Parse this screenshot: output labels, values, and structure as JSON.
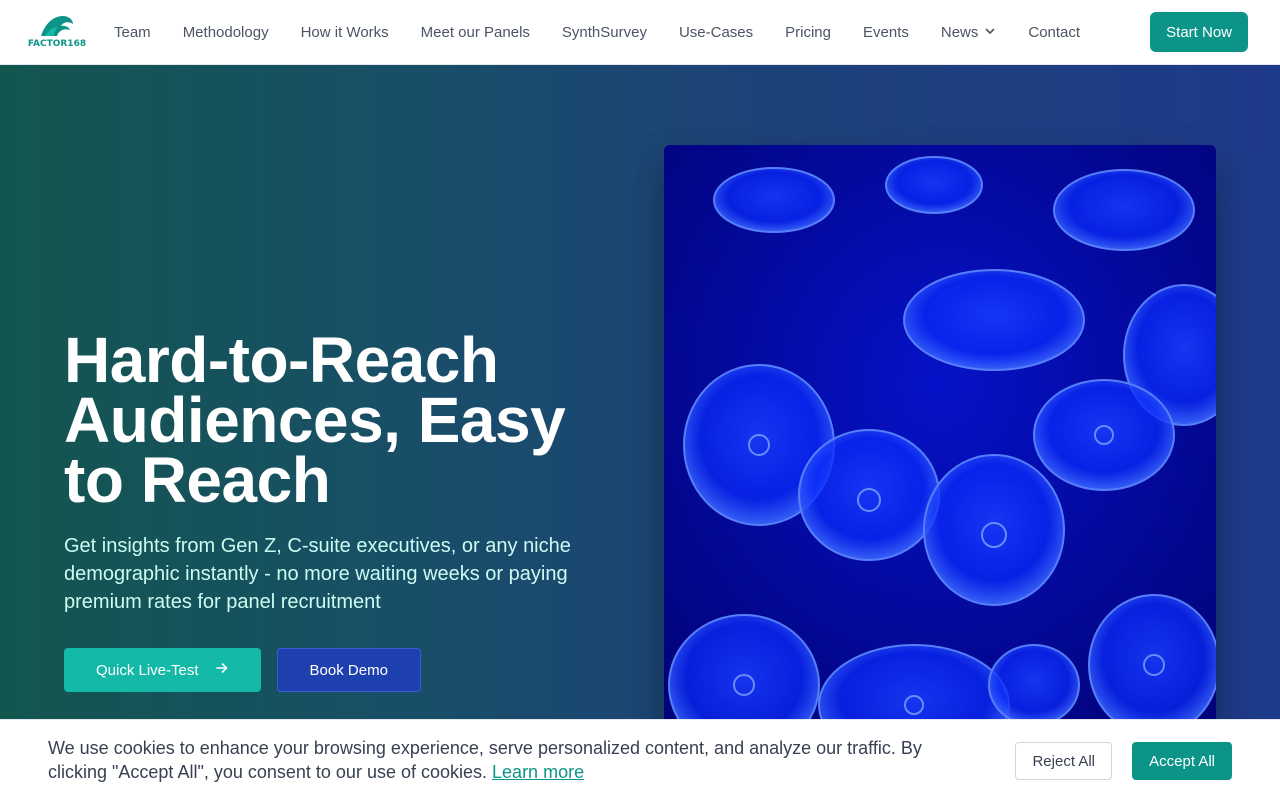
{
  "brand": {
    "logo_text": "FACTOR168",
    "accent": "#0d9488"
  },
  "nav": {
    "items": [
      {
        "label": "Team"
      },
      {
        "label": "Methodology"
      },
      {
        "label": "How it Works"
      },
      {
        "label": "Meet our Panels"
      },
      {
        "label": "SynthSurvey"
      },
      {
        "label": "Use-Cases"
      },
      {
        "label": "Pricing"
      },
      {
        "label": "Events"
      },
      {
        "label": "News",
        "icon": "chevron-down-icon"
      },
      {
        "label": "Contact"
      }
    ],
    "cta_label": "Start Now"
  },
  "hero": {
    "title_lines": [
      "Hard-to-Reach",
      "Audiences, Easy",
      "to Reach"
    ],
    "subtitle": "Get insights from Gen Z, C-suite executives, or any niche demographic instantly - no more waiting weeks or paying premium rates for panel recruitment",
    "primary_cta": "Quick Live-Test",
    "primary_cta_icon": "arrow-right-icon",
    "secondary_cta": "Book Demo",
    "image": "jellyfish-photo"
  },
  "cookie_banner": {
    "text": "We use cookies to enhance your browsing experience, serve personalized content, and analyze our traffic. By clicking \"Accept All\", you consent to our use of cookies.",
    "link_label": "Learn more",
    "reject_label": "Reject All",
    "accept_label": "Accept All"
  }
}
